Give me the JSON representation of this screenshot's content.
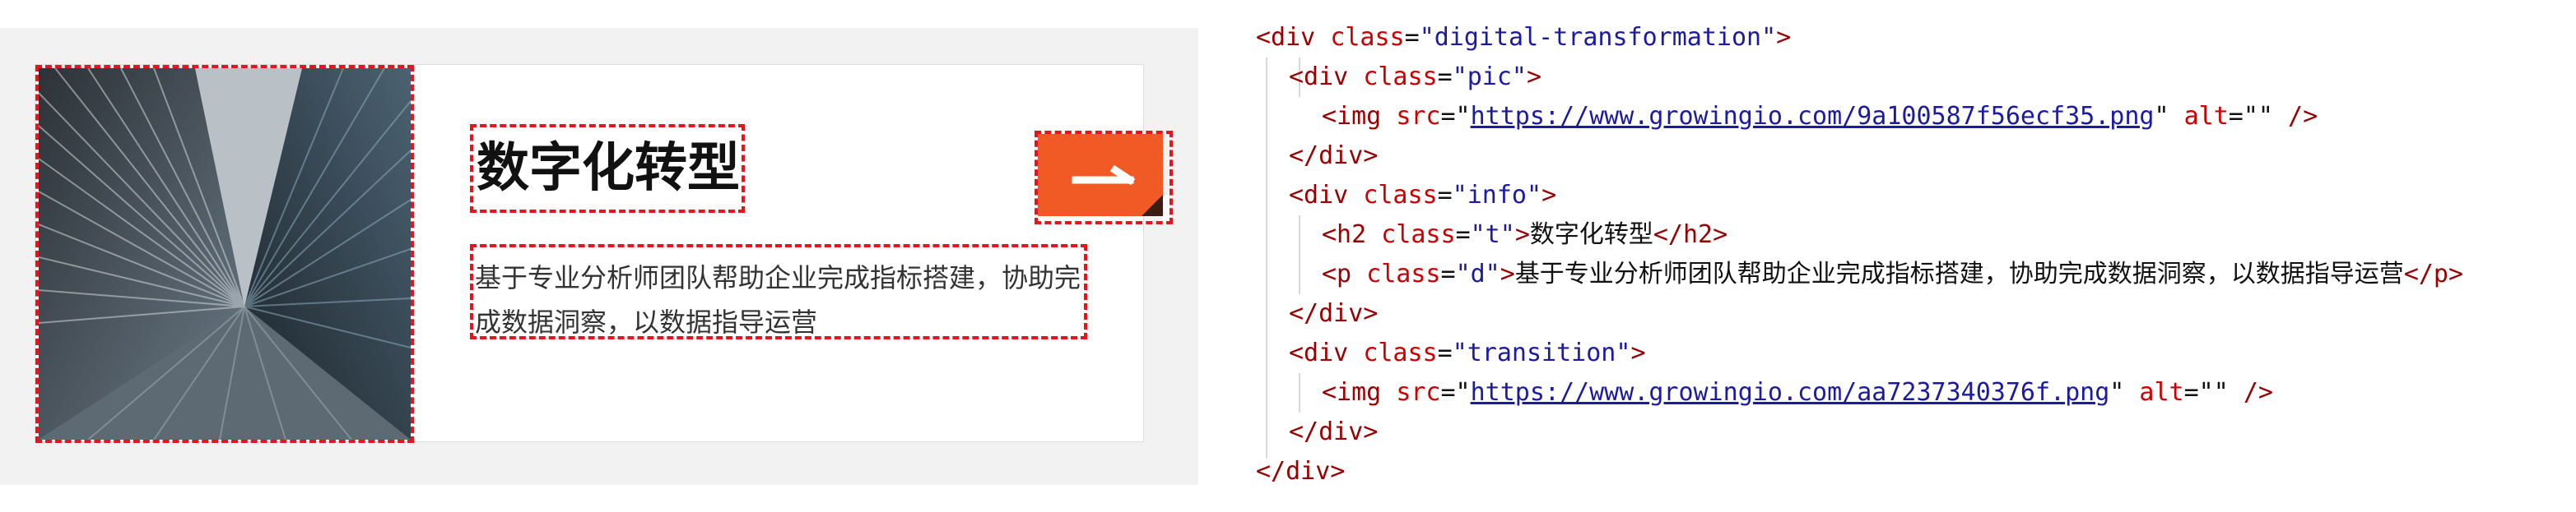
{
  "preview": {
    "title": "数字化转型",
    "description": "基于专业分析师团队帮助企业完成指标搭建，协助完成数据洞察，以数据指导运营",
    "colors": {
      "accent": "#f15a24",
      "highlight_border": "#e8141c",
      "background": "#f2f2f2"
    },
    "pic_icon": "building-photo",
    "transition_icon": "arrow-right-icon"
  },
  "code": {
    "l1": {
      "tag_open": "<div",
      "attr": "class",
      "eq": "=",
      "value": "\"digital-transformation\"",
      "close": ">"
    },
    "l2": {
      "tag_open": "<div",
      "attr": "class",
      "eq": "=",
      "value": "\"pic\"",
      "close": ">"
    },
    "l3": {
      "tag_open": "<img",
      "attr1": "src",
      "eq1": "=\"",
      "url": "https://www.growingio.com/9a100587f56ecf35.png",
      "q1": "\"",
      "attr2": "alt",
      "val2": "=\"\"",
      "close": "/>"
    },
    "l4": {
      "tag": "</div>"
    },
    "l5": {
      "tag_open": "<div",
      "attr": "class",
      "eq": "=",
      "value": "\"info\"",
      "close": ">"
    },
    "l6": {
      "tag_open": "<h2",
      "attr": "class",
      "eq": "=",
      "value": "\"t\"",
      "close": ">",
      "text": "数字化转型",
      "tag_close": "</h2>"
    },
    "l7": {
      "tag_open": "<p",
      "attr": "class",
      "eq": "=",
      "value": "\"d\"",
      "close": ">",
      "text": "基于专业分析师团队帮助企业完成指标搭建，协助完成数据洞察，以数据指导运营",
      "tag_close": "</p>"
    },
    "l8": {
      "tag": "</div>"
    },
    "l9": {
      "tag_open": "<div",
      "attr": "class",
      "eq": "=",
      "value": "\"transition\"",
      "close": ">"
    },
    "l10": {
      "tag_open": "<img",
      "attr1": "src",
      "eq1": "=\"",
      "url": "https://www.growingio.com/aa7237340376f.png",
      "q1": "\"",
      "attr2": "alt",
      "val2": "=\"\"",
      "close": "/>"
    },
    "l11": {
      "tag": "</div>"
    },
    "l12": {
      "tag": "</div>"
    }
  }
}
